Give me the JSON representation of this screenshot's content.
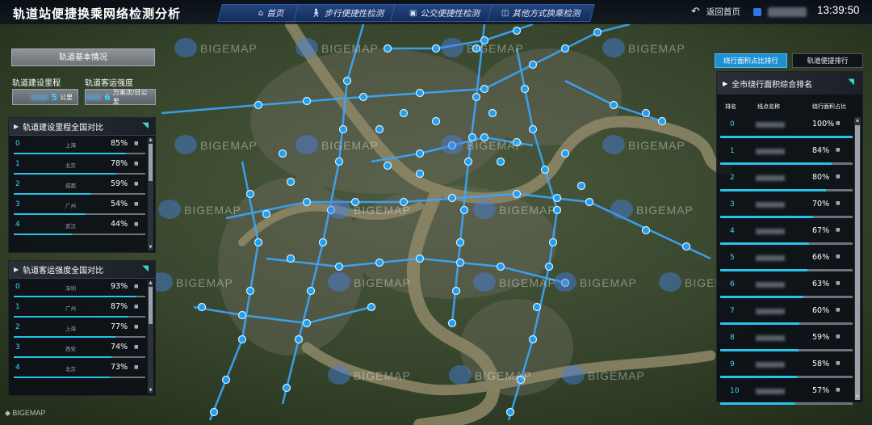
{
  "header": {
    "title": "轨道站便捷换乘网络检测分析",
    "tabs": [
      {
        "label": "首页",
        "icon": "home-icon"
      },
      {
        "label": "步行便捷性检测",
        "icon": "walk-icon"
      },
      {
        "label": "公交便捷性检测",
        "icon": "bus-icon"
      },
      {
        "label": "其他方式换乘检测",
        "icon": "car-icon"
      }
    ],
    "back_label": "返回首页",
    "clock": "13:39:50"
  },
  "map": {
    "watermark": "BIGEMAP",
    "bottom_logo": "BIGEMAP"
  },
  "rail_basic": {
    "title": "轨道基本情况",
    "length_label": "轨道建设里程",
    "intensity_label": "轨道客运强度",
    "length_value": "5",
    "length_unit": "公里",
    "intensity_value": "6",
    "intensity_unit": "万乘次/日公里"
  },
  "rank_length": {
    "title": "轨道建设里程全国对比",
    "rows": [
      {
        "idx": "0",
        "city": "上海",
        "pct": "85%",
        "value": 0.85
      },
      {
        "idx": "1",
        "city": "北京",
        "pct": "78%",
        "value": 0.78
      },
      {
        "idx": "2",
        "city": "成都",
        "pct": "59%",
        "value": 0.59
      },
      {
        "idx": "3",
        "city": "广州",
        "pct": "54%",
        "value": 0.54
      },
      {
        "idx": "4",
        "city": "武汉",
        "pct": "44%",
        "value": 0.44
      }
    ]
  },
  "rank_intensity": {
    "title": "轨道客运强度全国对比",
    "rows": [
      {
        "idx": "0",
        "city": "深圳",
        "pct": "93%",
        "value": 0.93
      },
      {
        "idx": "1",
        "city": "广州",
        "pct": "87%",
        "value": 0.87
      },
      {
        "idx": "2",
        "city": "上海",
        "pct": "77%",
        "value": 0.77
      },
      {
        "idx": "3",
        "city": "西安",
        "pct": "74%",
        "value": 0.74
      },
      {
        "idx": "4",
        "city": "北京",
        "pct": "73%",
        "value": 0.73
      }
    ]
  },
  "right": {
    "tabs": [
      "绕行面积占比排行",
      "轨道便捷排行"
    ],
    "active_tab": 0,
    "panel_title": "全市绕行面积综合排名",
    "col_rank": "排名",
    "col_name": "线点名称",
    "col_ratio": "绕行面积占比",
    "rows": [
      {
        "idx": "0",
        "pct": "100%",
        "value": 1.0
      },
      {
        "idx": "1",
        "pct": "84%",
        "value": 0.84
      },
      {
        "idx": "2",
        "pct": "80%",
        "value": 0.8
      },
      {
        "idx": "3",
        "pct": "70%",
        "value": 0.7
      },
      {
        "idx": "4",
        "pct": "67%",
        "value": 0.67
      },
      {
        "idx": "5",
        "pct": "66%",
        "value": 0.66
      },
      {
        "idx": "6",
        "pct": "63%",
        "value": 0.63
      },
      {
        "idx": "7",
        "pct": "60%",
        "value": 0.6
      },
      {
        "idx": "8",
        "pct": "59%",
        "value": 0.59
      },
      {
        "idx": "9",
        "pct": "58%",
        "value": 0.58
      },
      {
        "idx": "10",
        "pct": "57%",
        "value": 0.57
      }
    ]
  },
  "colors": {
    "accent": "#27c3e8",
    "tab_active": "#1d8fd3",
    "flag": "#37e0b8",
    "route": "#3aa8ff"
  }
}
